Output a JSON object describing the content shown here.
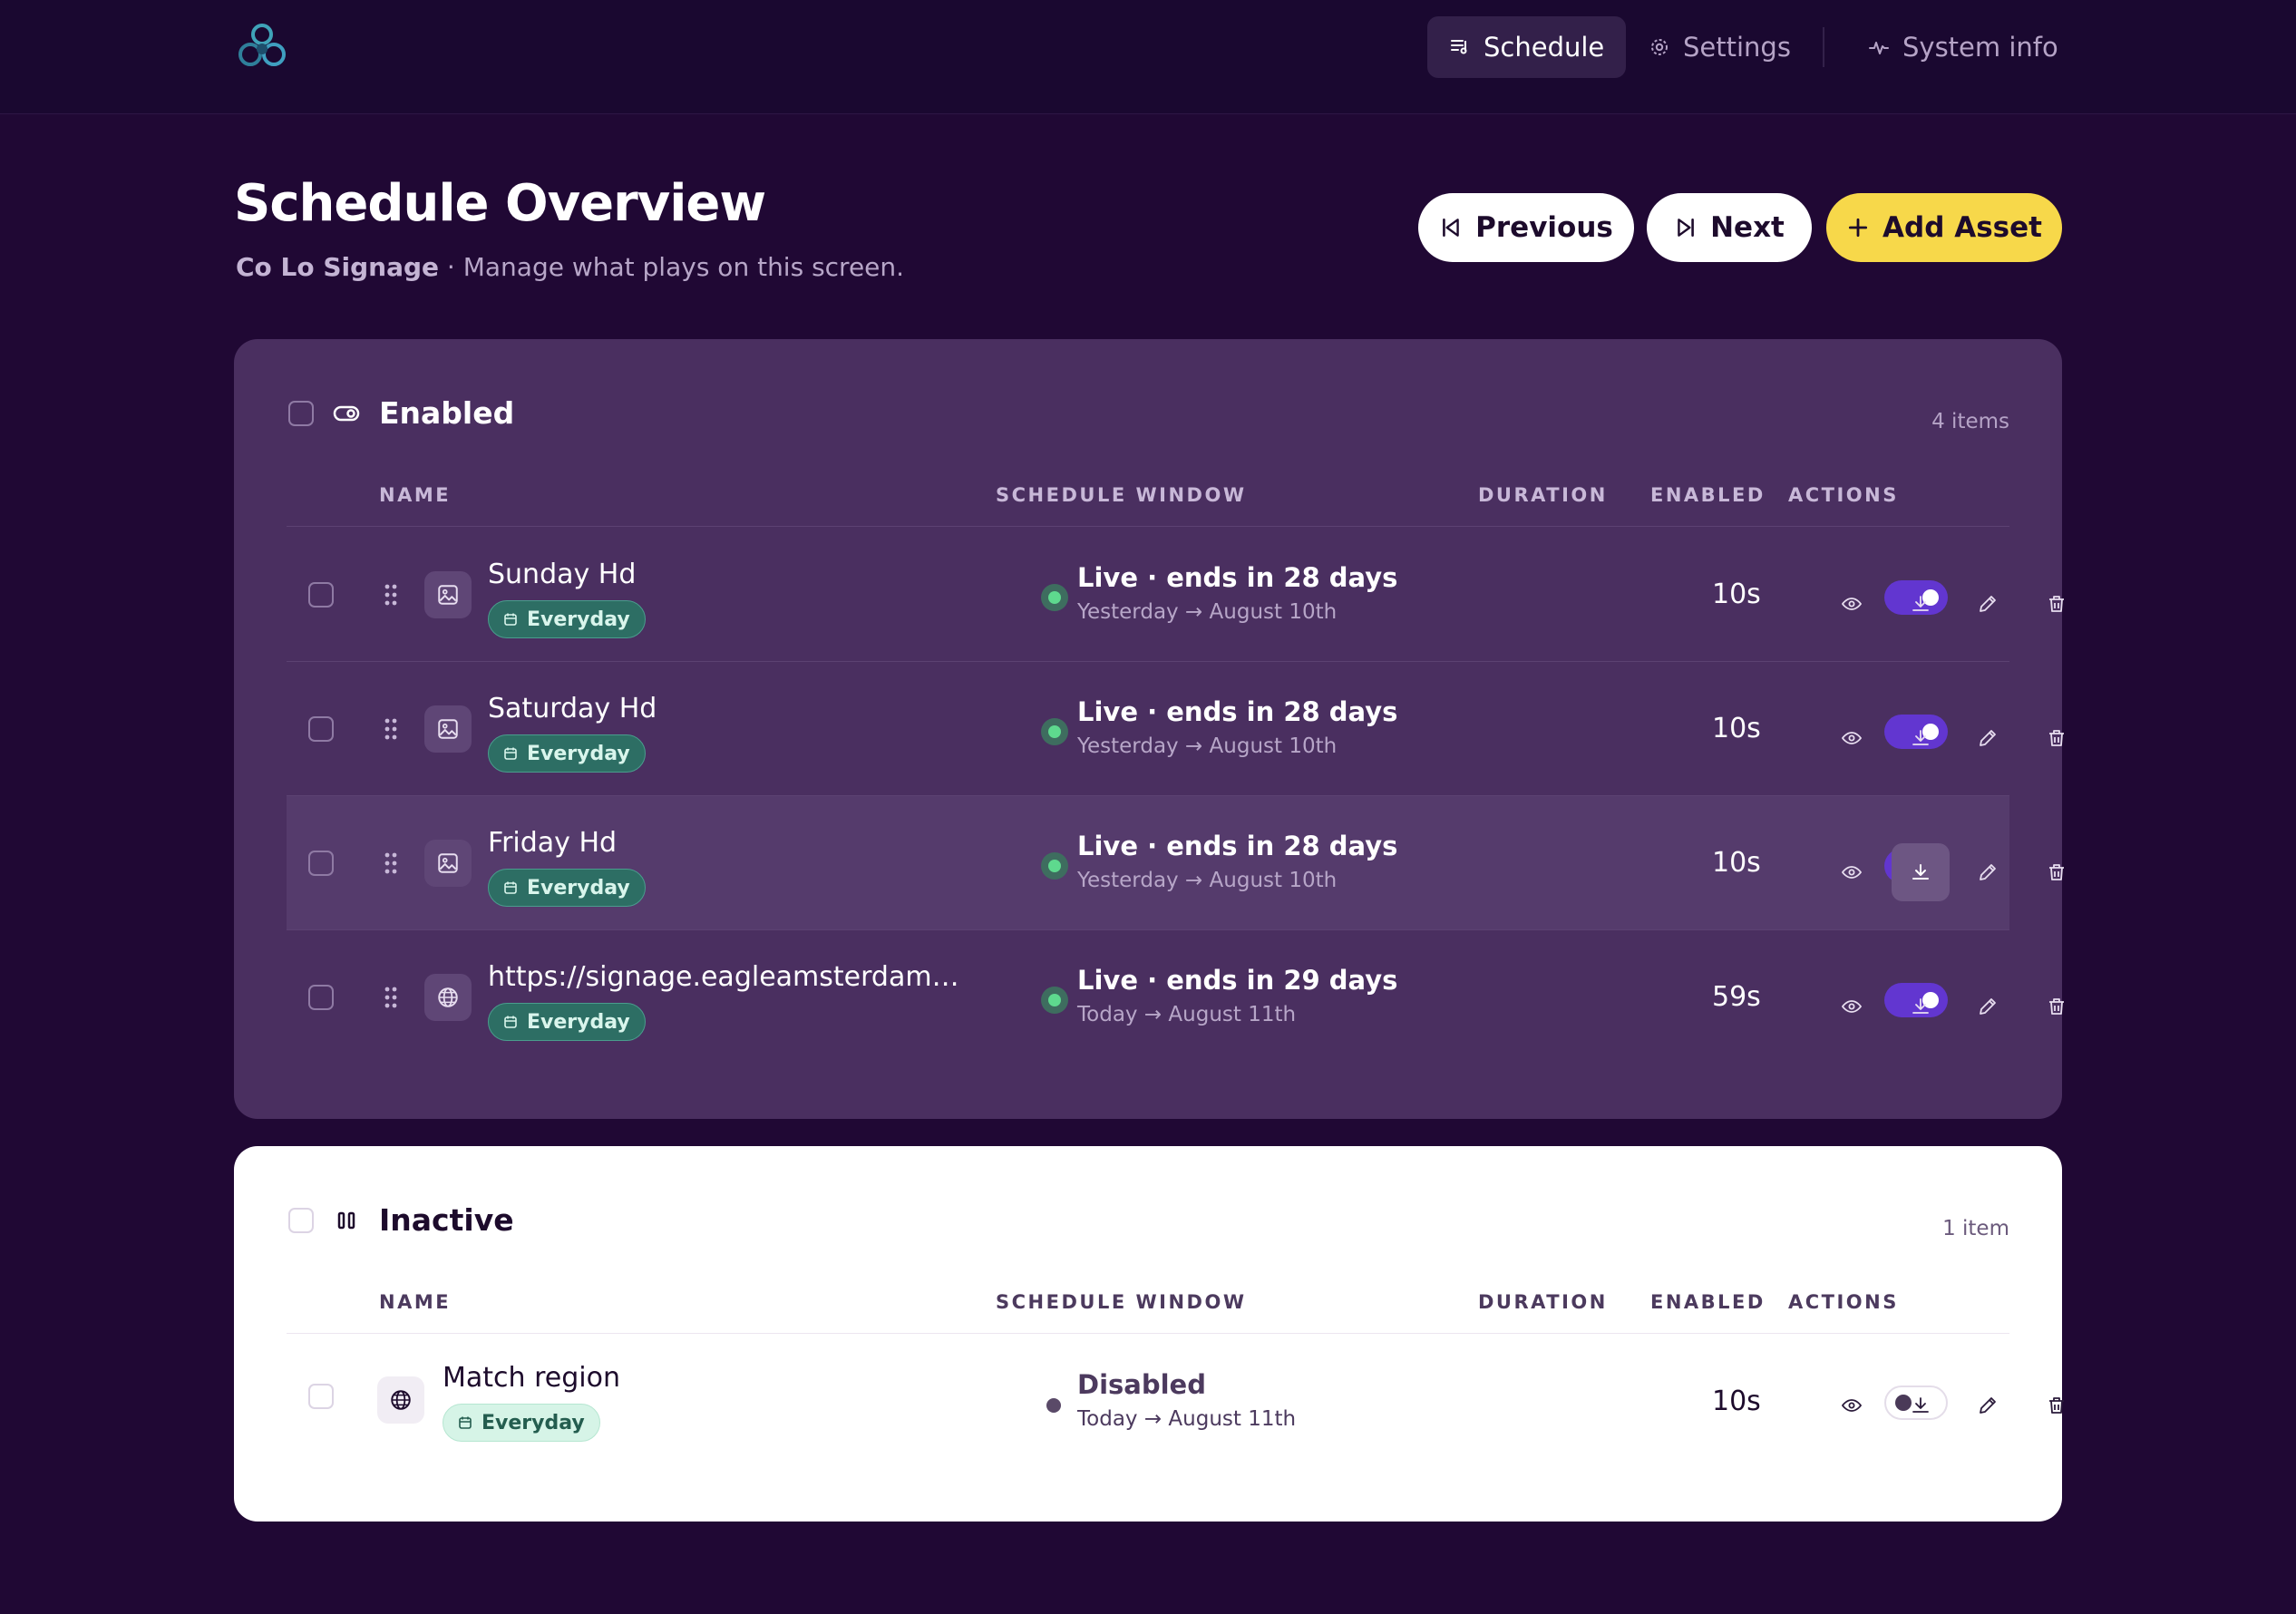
{
  "nav": {
    "items": [
      {
        "label": "Schedule",
        "active": true
      },
      {
        "label": "Settings",
        "active": false
      },
      {
        "label": "System info",
        "active": false
      }
    ]
  },
  "header": {
    "title": "Schedule Overview",
    "brand": "Co Lo Signage",
    "subtitle_rest": " · Manage what plays on this screen.",
    "buttons": {
      "previous": "Previous",
      "next": "Next",
      "add": "Add Asset"
    }
  },
  "columns": {
    "name": "NAME",
    "schedule": "SCHEDULE WINDOW",
    "duration": "DURATION",
    "enabled": "ENABLED",
    "actions": "ACTIONS"
  },
  "enabled_section": {
    "title": "Enabled",
    "count": "4 items",
    "rows": [
      {
        "name": "Sunday Hd",
        "type": "image",
        "badge": "Everyday",
        "status": "Live · ends in 28 days",
        "range": "Yesterday → August 10th",
        "duration": "10s",
        "enabled": true
      },
      {
        "name": "Saturday Hd",
        "type": "image",
        "badge": "Everyday",
        "status": "Live · ends in 28 days",
        "range": "Yesterday → August 10th",
        "duration": "10s",
        "enabled": true
      },
      {
        "name": "Friday Hd",
        "type": "image",
        "badge": "Everyday",
        "status": "Live · ends in 28 days",
        "range": "Yesterday → August 10th",
        "duration": "10s",
        "enabled": true
      },
      {
        "name": "https://signage.eagleamsterdam…",
        "type": "web",
        "badge": "Everyday",
        "status": "Live · ends in 29 days",
        "range": "Today → August 11th",
        "duration": "59s",
        "enabled": true
      }
    ]
  },
  "inactive_section": {
    "title": "Inactive",
    "count": "1 item",
    "rows": [
      {
        "name": "Match region",
        "type": "web",
        "badge": "Everyday",
        "status": "Disabled",
        "range": "Today → August 11th",
        "duration": "10s",
        "enabled": false
      }
    ]
  },
  "colors": {
    "background": "#200834",
    "card_enabled": "#4a2f60",
    "accent_yellow": "#f7d84a",
    "toggle_on": "#6236d0",
    "live_green": "#5ed98e"
  }
}
